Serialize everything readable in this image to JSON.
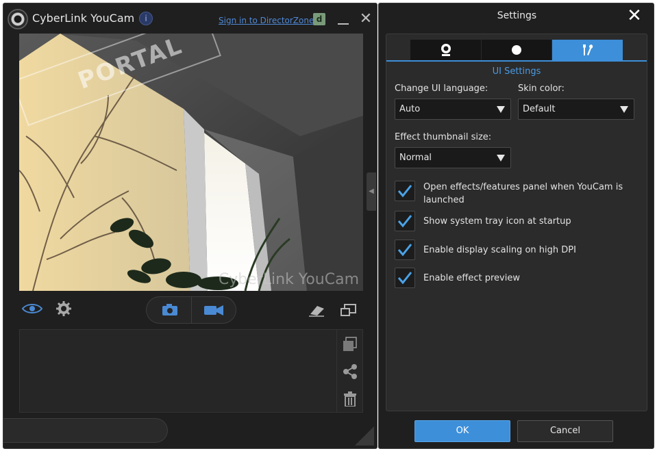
{
  "main_window": {
    "title": "CyberLink YouCam",
    "info_glyph": "i",
    "signin_link": "Sign in to DirectorZone",
    "directorzone_glyph": "d",
    "close_glyph": "✕",
    "camera_watermark": "CyberLink YouCam",
    "portal_watermark": "PORTAL",
    "side_handle_glyph": "◀",
    "icons": [
      "webcam-logo-icon",
      "info-icon",
      "directorzone-icon",
      "minimize-icon",
      "close-icon",
      "eye-icon",
      "gear-icon",
      "camera-icon",
      "video-camera-icon",
      "eraser-icon",
      "screen-icon",
      "gallery-icon",
      "share-icon",
      "trash-icon",
      "resize-grip-icon"
    ]
  },
  "settings": {
    "title": "Settings",
    "close_glyph": "✕",
    "tabs": [
      {
        "name": "camera-settings",
        "icon": "webcam-icon"
      },
      {
        "name": "capture-settings",
        "icon": "record-dot-icon"
      },
      {
        "name": "ui-settings",
        "icon": "tools-icon",
        "active": true
      }
    ],
    "section_title": "UI Settings",
    "language_label": "Change UI language:",
    "language_value": "Auto",
    "skin_label": "Skin color:",
    "skin_value": "Default",
    "thumb_label": "Effect thumbnail size:",
    "thumb_value": "Normal",
    "checkboxes": [
      {
        "label": "Open effects/features panel when YouCam is launched",
        "checked": true
      },
      {
        "label": "Show system tray icon at startup",
        "checked": true
      },
      {
        "label": "Enable display scaling on high DPI",
        "checked": true
      },
      {
        "label": "Enable effect preview",
        "checked": true
      }
    ],
    "ok_label": "OK",
    "cancel_label": "Cancel",
    "accent_color": "#3d8fd9",
    "check_color": "#4aa3e8"
  }
}
